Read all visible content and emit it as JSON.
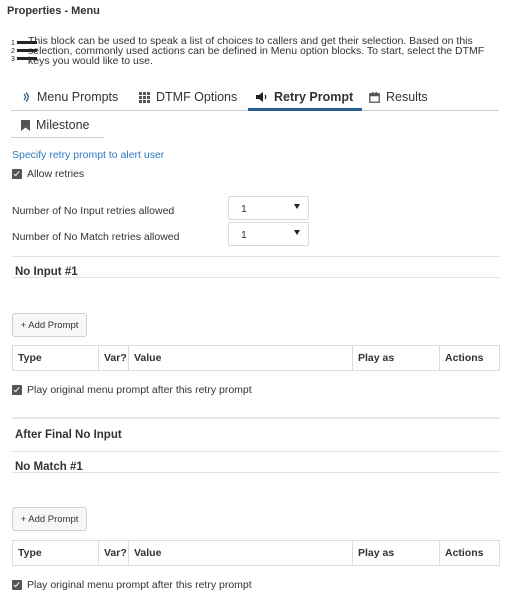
{
  "panel": {
    "title": "Properties - Menu",
    "description": "This block can be used to speak a list of choices to callers and get their selection. Based on this selection, commonly used actions can be defined in Menu option blocks. To start, select the DTMF keys you would like to use."
  },
  "tabs": [
    {
      "label": "Menu Prompts",
      "icon": "volume-icon",
      "active": false
    },
    {
      "label": "DTMF Options",
      "icon": "grid-icon",
      "active": false
    },
    {
      "label": "Retry Prompt",
      "icon": "speaker-icon",
      "active": true
    },
    {
      "label": "Results",
      "icon": "calendar-icon",
      "active": false
    },
    {
      "label": "Milestone",
      "icon": "bookmark-icon",
      "active": false
    }
  ],
  "retry": {
    "hint": "Specify retry prompt to alert user",
    "allow_retries_label": "Allow retries",
    "allow_retries_checked": true,
    "no_input_label": "Number of No Input retries allowed",
    "no_input_value": "1",
    "no_match_label": "Number of No Match retries allowed",
    "no_match_value": "1"
  },
  "sections": {
    "no_input_title": "No Input #1",
    "after_final_no_input_title": "After Final No Input",
    "no_match_title": "No Match #1",
    "add_prompt_label": "+ Add Prompt",
    "play_original_label": "Play original menu prompt after this retry prompt",
    "play_original_checked": true
  },
  "table": {
    "columns": [
      "Type",
      "Var?",
      "Value",
      "Play as",
      "Actions"
    ]
  }
}
